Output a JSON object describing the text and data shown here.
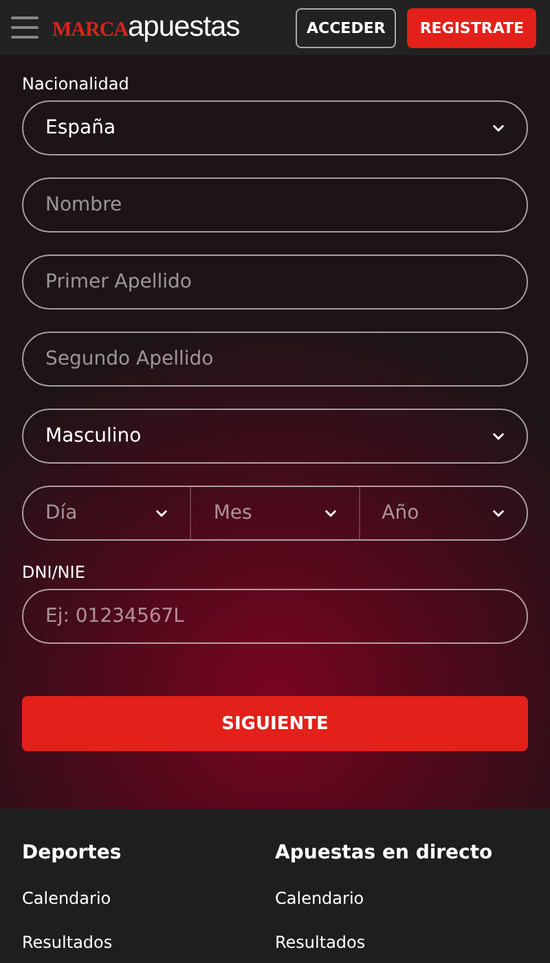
{
  "header": {
    "logo": {
      "brand": "MARCA",
      "product": "apuestas"
    },
    "buttons": [
      {
        "label": "ACCEDER",
        "kind": "outline"
      },
      {
        "label": "REGISTRATE",
        "kind": "primary"
      }
    ]
  },
  "form": {
    "fields": [
      {
        "kind": "select",
        "label": "Nacionalidad",
        "value": "España"
      },
      {
        "kind": "input",
        "placeholder": "Nombre"
      },
      {
        "kind": "input",
        "placeholder": "Primer Apellido"
      },
      {
        "kind": "input",
        "placeholder": "Segundo Apellido"
      },
      {
        "kind": "select",
        "value": "Masculino"
      },
      {
        "kind": "date",
        "parts": [
          {
            "placeholder": "Día"
          },
          {
            "placeholder": "Mes"
          },
          {
            "placeholder": "Año"
          }
        ]
      },
      {
        "kind": "input",
        "label": "DNI/NIE",
        "placeholder": "Ej: 01234567L"
      }
    ],
    "submit": "SIGUIENTE"
  },
  "footer": {
    "columns": [
      {
        "title": "Deportes",
        "links": [
          "Calendario",
          "Resultados"
        ]
      },
      {
        "title": "Apuestas en directo",
        "links": [
          "Calendario",
          "Resultados"
        ]
      }
    ]
  }
}
